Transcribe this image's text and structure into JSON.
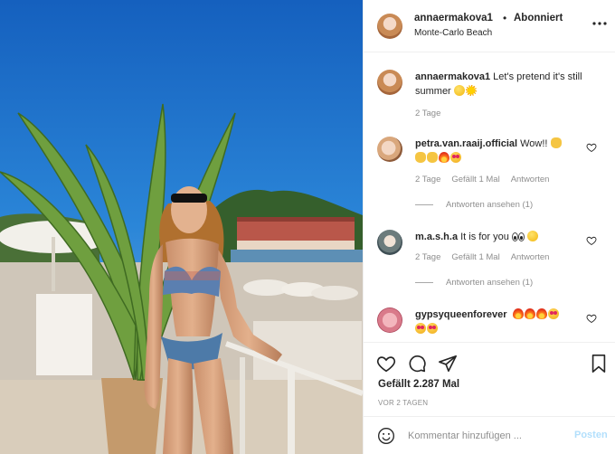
{
  "post": {
    "username": "annaermakova1",
    "separator": "•",
    "follow_status": "Abonniert",
    "location": "Monte-Carlo Beach",
    "more_icon": "more-horizontal-icon"
  },
  "caption": {
    "username": "annaermakova1",
    "text": "Let's pretend it's still summer",
    "emojis": [
      "smirk-emoji",
      "sun-emoji"
    ],
    "time": "2 Tage"
  },
  "comments": [
    {
      "username": "petra.van.raaij.official",
      "text": "Wow!!",
      "emojis_line1": [
        "clapping-hands-emoji"
      ],
      "emojis_line2": [
        "clapping-hands-emoji",
        "clapping-hands-emoji",
        "fire-emoji",
        "heart-eyes-emoji"
      ],
      "time": "2 Tage",
      "likes": "Gefällt 1 Mal",
      "reply": "Antworten",
      "view_replies": "Antworten ansehen (1)"
    },
    {
      "username": "m.a.s.h.a",
      "text": "It is for you",
      "emojis_line1": [
        "eyes-emoji",
        "smirk-emoji"
      ],
      "time": "2 Tage",
      "likes": "Gefällt 1 Mal",
      "reply": "Antworten",
      "view_replies": "Antworten ansehen (1)"
    },
    {
      "username": "gypsyqueenforever",
      "emojis_line1": [
        "fire-emoji",
        "fire-emoji",
        "fire-emoji",
        "heart-eyes-emoji"
      ],
      "emojis_line2": [
        "heart-eyes-emoji",
        "heart-eyes-emoji"
      ]
    }
  ],
  "actions": {
    "likes": "Gefällt 2.287 Mal",
    "timestamp": "VOR 2 TAGEN"
  },
  "add_comment": {
    "placeholder": "Kommentar hinzufügen ...",
    "post_label": "Posten"
  },
  "colors": {
    "text": "#262626",
    "muted": "#8e8e8e",
    "post_button_disabled": "#b2dffc",
    "sky": "#1e72c6"
  }
}
